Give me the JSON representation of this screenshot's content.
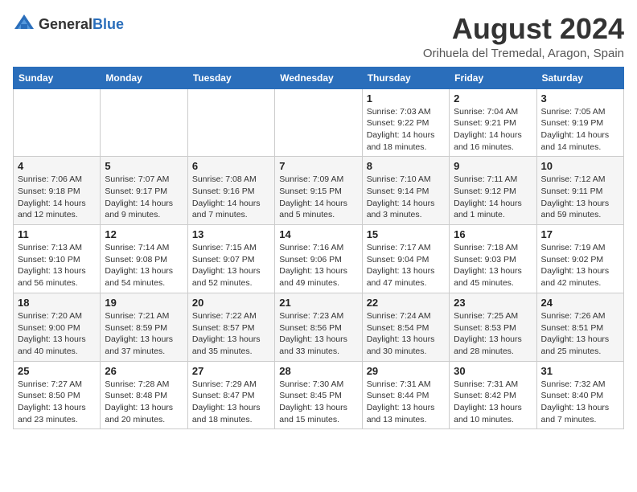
{
  "header": {
    "logo_general": "General",
    "logo_blue": "Blue",
    "month_year": "August 2024",
    "location": "Orihuela del Tremedal, Aragon, Spain"
  },
  "weekdays": [
    "Sunday",
    "Monday",
    "Tuesday",
    "Wednesday",
    "Thursday",
    "Friday",
    "Saturday"
  ],
  "weeks": [
    [
      {
        "day": "",
        "info": ""
      },
      {
        "day": "",
        "info": ""
      },
      {
        "day": "",
        "info": ""
      },
      {
        "day": "",
        "info": ""
      },
      {
        "day": "1",
        "info": "Sunrise: 7:03 AM\nSunset: 9:22 PM\nDaylight: 14 hours and 18 minutes."
      },
      {
        "day": "2",
        "info": "Sunrise: 7:04 AM\nSunset: 9:21 PM\nDaylight: 14 hours and 16 minutes."
      },
      {
        "day": "3",
        "info": "Sunrise: 7:05 AM\nSunset: 9:19 PM\nDaylight: 14 hours and 14 minutes."
      }
    ],
    [
      {
        "day": "4",
        "info": "Sunrise: 7:06 AM\nSunset: 9:18 PM\nDaylight: 14 hours and 12 minutes."
      },
      {
        "day": "5",
        "info": "Sunrise: 7:07 AM\nSunset: 9:17 PM\nDaylight: 14 hours and 9 minutes."
      },
      {
        "day": "6",
        "info": "Sunrise: 7:08 AM\nSunset: 9:16 PM\nDaylight: 14 hours and 7 minutes."
      },
      {
        "day": "7",
        "info": "Sunrise: 7:09 AM\nSunset: 9:15 PM\nDaylight: 14 hours and 5 minutes."
      },
      {
        "day": "8",
        "info": "Sunrise: 7:10 AM\nSunset: 9:14 PM\nDaylight: 14 hours and 3 minutes."
      },
      {
        "day": "9",
        "info": "Sunrise: 7:11 AM\nSunset: 9:12 PM\nDaylight: 14 hours and 1 minute."
      },
      {
        "day": "10",
        "info": "Sunrise: 7:12 AM\nSunset: 9:11 PM\nDaylight: 13 hours and 59 minutes."
      }
    ],
    [
      {
        "day": "11",
        "info": "Sunrise: 7:13 AM\nSunset: 9:10 PM\nDaylight: 13 hours and 56 minutes."
      },
      {
        "day": "12",
        "info": "Sunrise: 7:14 AM\nSunset: 9:08 PM\nDaylight: 13 hours and 54 minutes."
      },
      {
        "day": "13",
        "info": "Sunrise: 7:15 AM\nSunset: 9:07 PM\nDaylight: 13 hours and 52 minutes."
      },
      {
        "day": "14",
        "info": "Sunrise: 7:16 AM\nSunset: 9:06 PM\nDaylight: 13 hours and 49 minutes."
      },
      {
        "day": "15",
        "info": "Sunrise: 7:17 AM\nSunset: 9:04 PM\nDaylight: 13 hours and 47 minutes."
      },
      {
        "day": "16",
        "info": "Sunrise: 7:18 AM\nSunset: 9:03 PM\nDaylight: 13 hours and 45 minutes."
      },
      {
        "day": "17",
        "info": "Sunrise: 7:19 AM\nSunset: 9:02 PM\nDaylight: 13 hours and 42 minutes."
      }
    ],
    [
      {
        "day": "18",
        "info": "Sunrise: 7:20 AM\nSunset: 9:00 PM\nDaylight: 13 hours and 40 minutes."
      },
      {
        "day": "19",
        "info": "Sunrise: 7:21 AM\nSunset: 8:59 PM\nDaylight: 13 hours and 37 minutes."
      },
      {
        "day": "20",
        "info": "Sunrise: 7:22 AM\nSunset: 8:57 PM\nDaylight: 13 hours and 35 minutes."
      },
      {
        "day": "21",
        "info": "Sunrise: 7:23 AM\nSunset: 8:56 PM\nDaylight: 13 hours and 33 minutes."
      },
      {
        "day": "22",
        "info": "Sunrise: 7:24 AM\nSunset: 8:54 PM\nDaylight: 13 hours and 30 minutes."
      },
      {
        "day": "23",
        "info": "Sunrise: 7:25 AM\nSunset: 8:53 PM\nDaylight: 13 hours and 28 minutes."
      },
      {
        "day": "24",
        "info": "Sunrise: 7:26 AM\nSunset: 8:51 PM\nDaylight: 13 hours and 25 minutes."
      }
    ],
    [
      {
        "day": "25",
        "info": "Sunrise: 7:27 AM\nSunset: 8:50 PM\nDaylight: 13 hours and 23 minutes."
      },
      {
        "day": "26",
        "info": "Sunrise: 7:28 AM\nSunset: 8:48 PM\nDaylight: 13 hours and 20 minutes."
      },
      {
        "day": "27",
        "info": "Sunrise: 7:29 AM\nSunset: 8:47 PM\nDaylight: 13 hours and 18 minutes."
      },
      {
        "day": "28",
        "info": "Sunrise: 7:30 AM\nSunset: 8:45 PM\nDaylight: 13 hours and 15 minutes."
      },
      {
        "day": "29",
        "info": "Sunrise: 7:31 AM\nSunset: 8:44 PM\nDaylight: 13 hours and 13 minutes."
      },
      {
        "day": "30",
        "info": "Sunrise: 7:31 AM\nSunset: 8:42 PM\nDaylight: 13 hours and 10 minutes."
      },
      {
        "day": "31",
        "info": "Sunrise: 7:32 AM\nSunset: 8:40 PM\nDaylight: 13 hours and 7 minutes."
      }
    ]
  ]
}
